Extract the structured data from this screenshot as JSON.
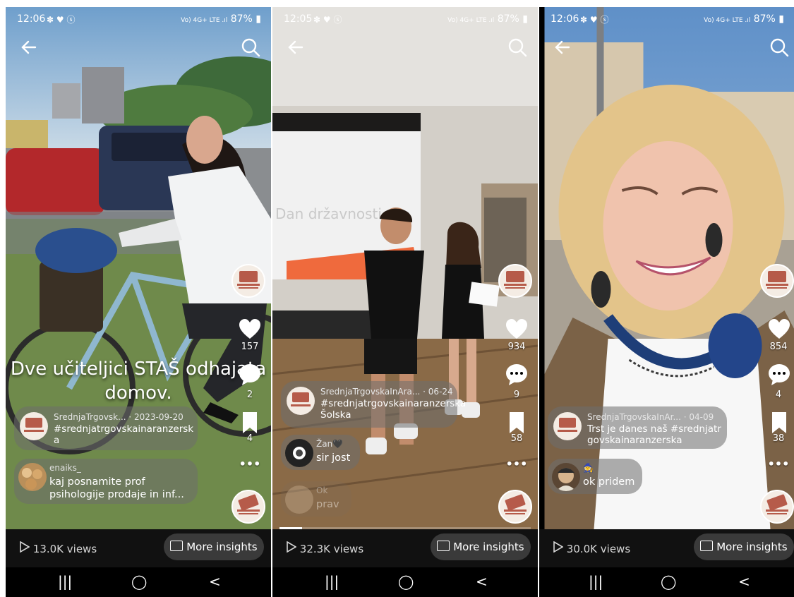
{
  "phones": [
    {
      "status": {
        "time": "12:06",
        "icons": "✽ ♥ ⓢ",
        "network": "Vo) 4G+ LTE .ıl",
        "battery": "87%"
      },
      "video_caption": "Dve učiteljici STAŠ odhajata domov.",
      "rail": {
        "likes": "157",
        "comments": "2",
        "saves": "4",
        "more": "•••"
      },
      "post": {
        "meta": "SrednjaTrgovsk... · 2023-09-20",
        "caption": "#srednjatrgovskainaranzerska"
      },
      "comments": [
        {
          "name": "enaiks_",
          "text": "kaj posnamite prof psihologije prodaje in inf..."
        }
      ],
      "views": "13.0K views",
      "insights": "More insights",
      "progress": 0.0
    },
    {
      "status": {
        "time": "12:05",
        "icons": "✽ ♥ ⓢ",
        "network": "Vo) 4G+ LTE .ıl",
        "battery": "87%"
      },
      "screen_text": "Dan državnosti",
      "rail": {
        "likes": "934",
        "comments": "9",
        "saves": "58",
        "more": "•••"
      },
      "post": {
        "meta": "SrednjaTrgovskaInAra... · 06-24",
        "caption": "#srednjatrgovskainaranzerska Šolska"
      },
      "comments": [
        {
          "name": "Žan🖤",
          "text": "sir jost"
        },
        {
          "name": "Ok",
          "text": "prav"
        }
      ],
      "views": "32.3K views",
      "insights": "More insights",
      "progress": 0.09
    },
    {
      "status": {
        "time": "12:06",
        "icons": "✽ ♥ ⓢ",
        "network": "Vo) 4G+ LTE .ıl",
        "battery": "87%"
      },
      "rail": {
        "likes": "854",
        "comments": "4",
        "saves": "38",
        "more": "•••"
      },
      "post": {
        "meta": "SrednjaTrgovskaInAr... · 04-09",
        "caption": "Trst je danes naš #srednjatrgovskainaranzerska"
      },
      "comments": [
        {
          "name": "🧙",
          "text": "ok pridem"
        }
      ],
      "views": "30.0K views",
      "insights": "More insights",
      "progress": 0.0
    }
  ],
  "nav": {
    "recent": "|||",
    "home": "◯",
    "back": "<"
  }
}
